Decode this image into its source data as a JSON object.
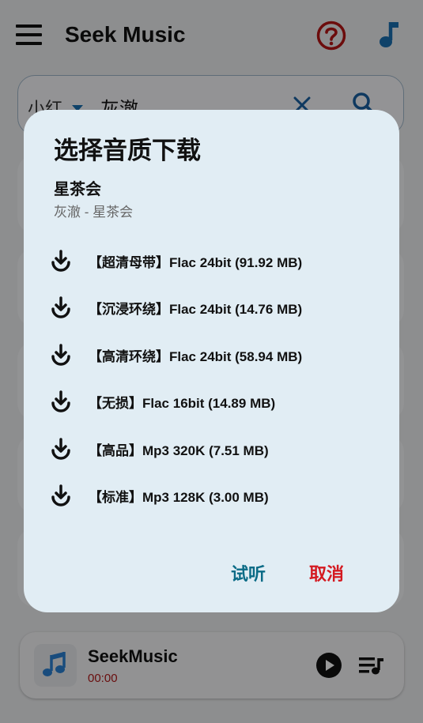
{
  "app": {
    "title": "Seek Music",
    "colors": {
      "accent_red": "#c91a1a",
      "note_blue": "#1a6fb0",
      "dialog_bg": "#e1edf4",
      "listen_teal": "#0b6b86",
      "cancel_red": "#d41920"
    }
  },
  "header": {
    "icons": {
      "menu": "hamburger-icon",
      "help": "question-circle-icon",
      "music": "music-note-icon"
    }
  },
  "search": {
    "source": "小红",
    "query": "灰澈",
    "icons": {
      "clear": "close-icon",
      "search": "search-icon"
    }
  },
  "dialog": {
    "title": "选择音质下载",
    "song_name": "星茶会",
    "song_sub": "灰澈 - 星茶会",
    "options": [
      {
        "label": "【超清母带】Flac 24bit (91.92 MB)",
        "icon": "download-icon"
      },
      {
        "label": "【沉浸环绕】Flac 24bit (14.76 MB)",
        "icon": "download-icon"
      },
      {
        "label": "【高清环绕】Flac 24bit (58.94 MB)",
        "icon": "download-icon"
      },
      {
        "label": "【无损】Flac 16bit (14.89 MB)",
        "icon": "download-icon"
      },
      {
        "label": "【高品】Mp3 320K (7.51 MB)",
        "icon": "download-icon"
      },
      {
        "label": "【标准】Mp3 128K (3.00 MB)",
        "icon": "download-icon"
      }
    ],
    "listen_label": "试听",
    "cancel_label": "取消"
  },
  "player": {
    "title": "SeekMusic",
    "time": "00:00",
    "icons": {
      "art": "music-note-icon",
      "play": "play-icon",
      "queue": "playlist-icon"
    }
  }
}
